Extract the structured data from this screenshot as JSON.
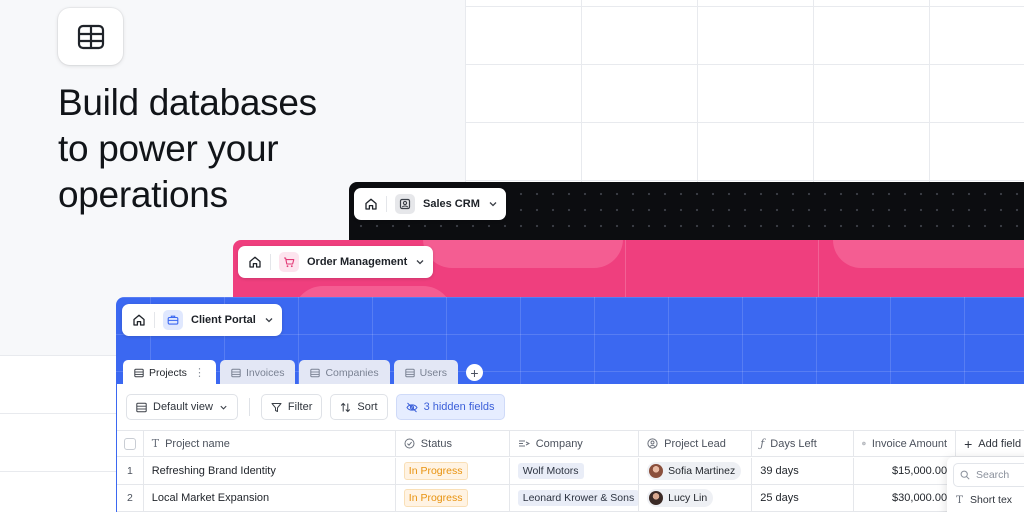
{
  "headline": {
    "line1": "Build databases",
    "line2": "to power your",
    "line3": "operations"
  },
  "colors": {
    "crm_bg": "#0c0d10",
    "order_bg": "#ef3f7e",
    "client_bg": "#3b68f1",
    "status_in_progress": "#e8920e"
  },
  "workspaces": {
    "crm": {
      "label": "Sales CRM",
      "icon": "contact-card-icon"
    },
    "order": {
      "label": "Order Management",
      "icon": "cart-icon"
    },
    "client": {
      "label": "Client Portal",
      "icon": "briefcase-icon"
    }
  },
  "tabs": [
    {
      "label": "Projects",
      "active": true
    },
    {
      "label": "Invoices",
      "active": false
    },
    {
      "label": "Companies",
      "active": false
    },
    {
      "label": "Users",
      "active": false
    }
  ],
  "toolbar": {
    "view_label": "Default view",
    "filter_label": "Filter",
    "sort_label": "Sort",
    "hidden_fields_label": "3 hidden fields"
  },
  "columns": {
    "name": "Project name",
    "status": "Status",
    "company": "Company",
    "lead": "Project Lead",
    "days": "Days Left",
    "amount": "Invoice Amount",
    "add": "Add field"
  },
  "rows": [
    {
      "index": "1",
      "name": "Refreshing Brand Identity",
      "status": "In Progress",
      "company": "Wolf Motors",
      "lead": "Sofia Martinez",
      "days": "39 days",
      "amount": "$15,000.00"
    },
    {
      "index": "2",
      "name": "Local Market Expansion",
      "status": "In Progress",
      "company": "Leonard Krower & Sons",
      "lead": "Lucy Lin",
      "days": "25 days",
      "amount": "$30,000.00"
    }
  ],
  "field_popup": {
    "search_placeholder": "Search",
    "first_item": "Short tex"
  }
}
